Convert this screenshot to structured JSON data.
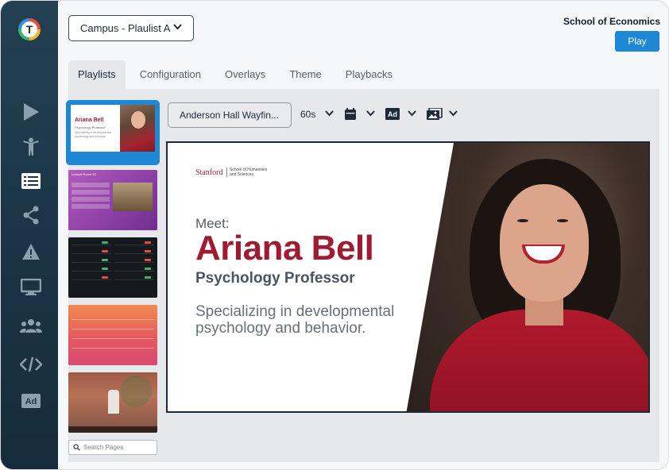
{
  "header": {
    "campus_select": "Campus - Plaulist A",
    "org_name": "School of Economics",
    "play_label": "Play"
  },
  "tabs": [
    {
      "label": "Playlists",
      "active": true
    },
    {
      "label": "Configuration"
    },
    {
      "label": "Overlays"
    },
    {
      "label": "Theme"
    },
    {
      "label": "Playbacks"
    }
  ],
  "sidebar": {
    "logo_letter": "T",
    "icons": [
      "play-icon",
      "person-icon",
      "list-icon",
      "share-icon",
      "warning-icon",
      "monitor-icon",
      "users-icon",
      "code-icon",
      "ad-icon"
    ]
  },
  "thumbnails": {
    "t1": {
      "name": "Ariana Bell",
      "sub": "Psychology Professor",
      "sub2": "Specializing in developmental psychology and behavior"
    },
    "t2": {
      "title": "Lecture Room 3C"
    }
  },
  "toolbar": {
    "page_select": "Anderson Hall  Wayfin...",
    "duration": "60s",
    "icons": [
      "calendar-icon",
      "ad-icon",
      "image-icon"
    ]
  },
  "search": {
    "placeholder": "Search Pages"
  },
  "preview": {
    "logo": "Stanford",
    "logo_sub": "School of Humanities and Sciences",
    "meet": "Meet:",
    "name": "Ariana Bell",
    "title": "Psychology Professor",
    "description": "Specializing in developmental psychology and behavior."
  },
  "colors": {
    "accent": "#1e88d6",
    "brand": "#9e1b32",
    "sidebar": "#1b3546"
  }
}
